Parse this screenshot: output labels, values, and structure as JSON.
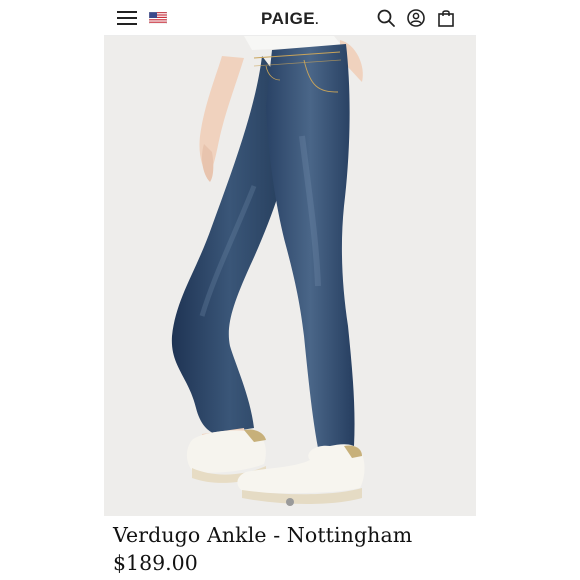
{
  "header": {
    "brand": "PAIGE",
    "brand_mark": "."
  },
  "icons": {
    "menu": "hamburger-menu-icon",
    "flag": "us-flag-icon",
    "search": "search-icon",
    "account": "account-icon",
    "bag": "shopping-bag-icon"
  },
  "product": {
    "name": "Verdugo Ankle - Nottingham",
    "price": "$189.00"
  },
  "colors": {
    "denim": "#2f4a6b",
    "background": "#eeedeb",
    "text": "#111111"
  }
}
